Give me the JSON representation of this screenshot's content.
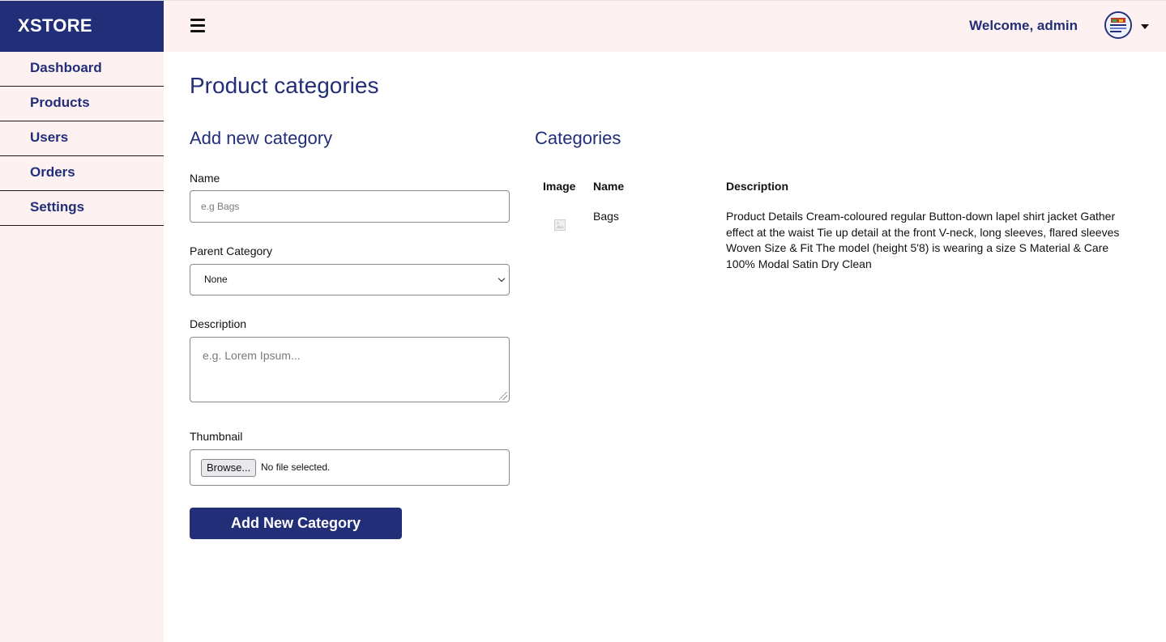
{
  "brand": "XSTORE",
  "sidebar": {
    "items": [
      {
        "label": "Dashboard"
      },
      {
        "label": "Products"
      },
      {
        "label": "Users"
      },
      {
        "label": "Orders"
      },
      {
        "label": "Settings"
      }
    ]
  },
  "header": {
    "welcome": "Welcome, admin",
    "menu_icon": "hamburger-icon",
    "avatar_icon": "avatar",
    "dropdown_icon": "caret-down-icon"
  },
  "page": {
    "title": "Product categories"
  },
  "form": {
    "title": "Add new category",
    "name_label": "Name",
    "name_placeholder": "e.g Bags",
    "parent_label": "Parent Category",
    "parent_value": "None",
    "description_label": "Description",
    "description_placeholder": "e.g. Lorem Ipsum...",
    "thumbnail_label": "Thumbnail",
    "browse_label": "Browse...",
    "file_status": "No file selected.",
    "submit_label": "Add New Category"
  },
  "categories": {
    "title": "Categories",
    "columns": [
      "Image",
      "Name",
      "Description"
    ],
    "rows": [
      {
        "image_icon": "broken-image-icon",
        "name": "Bags",
        "description": "Product Details Cream-coloured regular Button-down lapel shirt jacket Gather effect at the waist Tie up detail at the front V-neck, long sleeves, flared sleeves Woven Size & Fit The model (height 5'8) is wearing a size S Material & Care 100% Modal Satin Dry Clean"
      }
    ]
  },
  "colors": {
    "brand": "#232e78",
    "sidebar_bg": "#fdf2f1"
  }
}
